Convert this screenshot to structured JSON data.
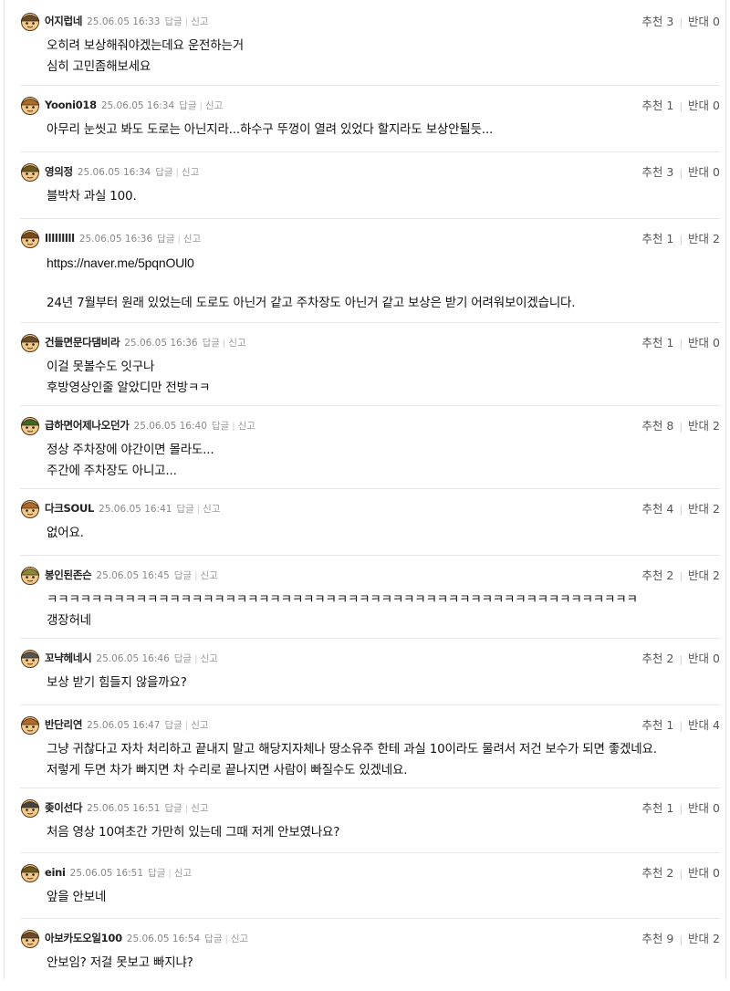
{
  "labels": {
    "reply": "답글",
    "report": "신고",
    "up": "추천",
    "down": "반대"
  },
  "comments": [
    {
      "nick": "어지럽네",
      "date": "25.06.05 16:33",
      "up": "3",
      "down": "0",
      "lines": [
        "오히려 보상해줘야겠는데요 운전하는거",
        "심히 고민좀해보세요"
      ],
      "cap": "#6b4a2a"
    },
    {
      "nick": "Yooni018",
      "date": "25.06.05 16:34",
      "up": "1",
      "down": "0",
      "lines": [
        "아무리 눈씻고 봐도 도로는 아닌지라...하수구 뚜껑이 열려 있었다 할지라도 보상안될듯..."
      ],
      "cap": "#b06a2a"
    },
    {
      "nick": "영의정",
      "date": "25.06.05 16:34",
      "up": "3",
      "down": "0",
      "lines": [
        "블박차 과실 100."
      ],
      "cap": "#6b5a20"
    },
    {
      "nick": "lllllllll",
      "date": "25.06.05 16:36",
      "up": "1",
      "down": "2",
      "lines": [
        "https://naver.me/5pqnOUl0",
        "",
        "24년 7월부터 원래 있었는데 도로도 아닌거 같고 주차장도 아닌거 같고 보상은 받기 어려워보이겠습니다."
      ],
      "cap": "#7a4a1a"
    },
    {
      "nick": "건들면문다댐비라",
      "date": "25.06.05 16:36",
      "up": "1",
      "down": "0",
      "lines": [
        "이걸 못볼수도 잇구나",
        "후방영상인줄 알았디만 전방ㅋㅋ"
      ],
      "cap": "#6b4a2a"
    },
    {
      "nick": "급하면어제나오던가",
      "date": "25.06.05 16:40",
      "up": "8",
      "down": "2",
      "lines": [
        "정상 주차장에 야간이면 몰라도...",
        "주간에 주차장도 아니고..."
      ],
      "cap": "#3a6a2a"
    },
    {
      "nick": "다크SOUL",
      "date": "25.06.05 16:41",
      "up": "4",
      "down": "2",
      "lines": [
        "없어요."
      ],
      "cap": "#b06a2a"
    },
    {
      "nick": "봉인된존슨",
      "date": "25.06.05 16:45",
      "up": "2",
      "down": "2",
      "lines": [
        "ㅋㅋㅋㅋㅋㅋㅋㅋㅋㅋㅋㅋㅋㅋㅋㅋㅋㅋㅋㅋㅋㅋㅋㅋㅋㅋㅋㅋㅋㅋㅋㅋㅋㅋㅋㅋㅋㅋㅋㅋㅋㅋㅋㅋㅋㅋㅋㅋㅋㅋㅋㅋㅋ",
        "갱장허네"
      ],
      "cap": "#8a8a3a"
    },
    {
      "nick": "꼬냑헤네시",
      "date": "25.06.05 16:46",
      "up": "2",
      "down": "0",
      "lines": [
        "보상 받기 힘들지 않을까요?"
      ],
      "cap": "#555555"
    },
    {
      "nick": "반단리연",
      "date": "25.06.05 16:47",
      "up": "1",
      "down": "4",
      "lines": [
        "그냥 귀찮다고 자차 처리하고 끝내지 말고 해당지자체나 땅소유주 한테 과실 10이라도 물려서 저건 보수가 되면 좋겠네요.",
        "저렇게 두면 차가 빠지면 차 수리로 끝나지면 사람이 빠질수도 있겠네요."
      ],
      "cap": "#b06a2a"
    },
    {
      "nick": "좆이선다",
      "date": "25.06.05 16:51",
      "up": "1",
      "down": "0",
      "lines": [
        "처음 영상 10여초간 가만히 있는데 그때 저게 안보였나요?"
      ],
      "cap": "#444444"
    },
    {
      "nick": "eini",
      "date": "25.06.05 16:51",
      "up": "2",
      "down": "0",
      "lines": [
        "앞을 안보네"
      ],
      "cap": "#6b5a20"
    },
    {
      "nick": "아보카도오일100",
      "date": "25.06.05 16:54",
      "up": "9",
      "down": "2",
      "lines": [
        "안보임? 저걸 못보고 빠지냐?"
      ],
      "cap": "#6b4a2a"
    }
  ]
}
